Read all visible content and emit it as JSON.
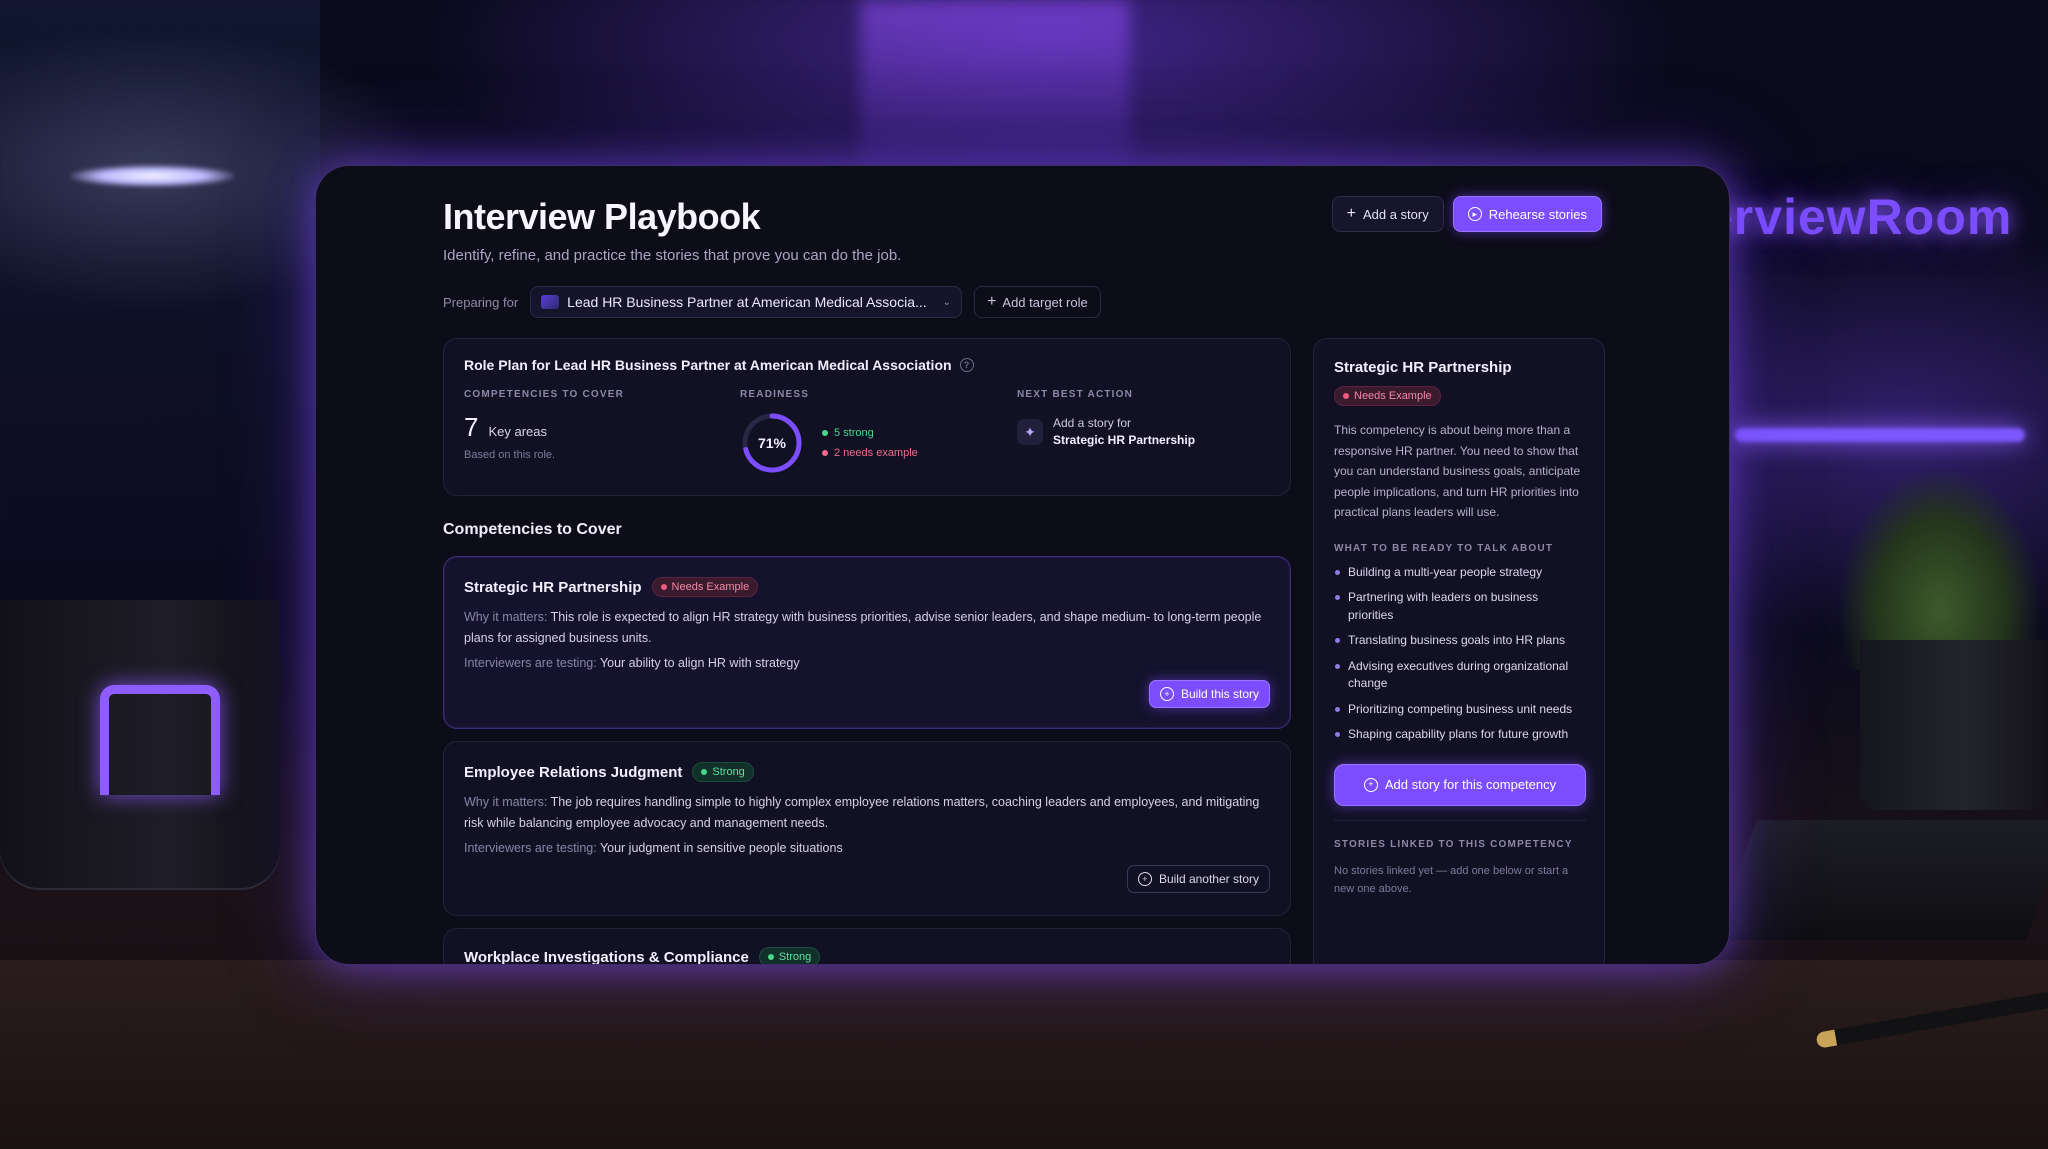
{
  "brand": {
    "neon_text": "erviewRoom"
  },
  "header": {
    "title": "Interview Playbook",
    "subtitle": "Identify, refine, and practice the stories that prove you can do the job.",
    "add_story_label": "Add a story",
    "rehearse_label": "Rehearse stories"
  },
  "prep": {
    "label": "Preparing for",
    "role": "Lead HR Business Partner at American Medical Associa...",
    "add_target_label": "Add target role"
  },
  "plan": {
    "title": "Role Plan for Lead HR Business Partner at American Medical Association",
    "competencies_kicker": "COMPETENCIES TO COVER",
    "competencies_count": "7",
    "competencies_unit": "Key areas",
    "competencies_note": "Based on this role.",
    "readiness_kicker": "READINESS",
    "readiness_percent": "71%",
    "readiness_value": 0.71,
    "strong_label": "5 strong",
    "needs_label": "2 needs example",
    "next_kicker": "NEXT BEST ACTION",
    "next_line1": "Add a story for",
    "next_line2": "Strategic HR Partnership"
  },
  "competencies": {
    "section_title": "Competencies to Cover",
    "items": [
      {
        "name": "Strategic HR Partnership",
        "badge": "Needs Example",
        "why_label": "Why it matters:",
        "why": "This role is expected to align HR strategy with business priorities, advise senior leaders, and shape medium- to long-term people plans for assigned business units.",
        "test_label": "Interviewers are testing:",
        "test": "Your ability to align HR with strategy",
        "button": "Build this story"
      },
      {
        "name": "Employee Relations Judgment",
        "badge": "Strong",
        "why_label": "Why it matters:",
        "why": "The job requires handling simple to highly complex employee relations matters, coaching leaders and employees, and mitigating risk while balancing employee advocacy and management needs.",
        "test_label": "Interviewers are testing:",
        "test": "Your judgment in sensitive people situations",
        "button": "Build another story"
      },
      {
        "name": "Workplace Investigations & Compliance",
        "badge": "Strong"
      }
    ]
  },
  "side": {
    "title": "Strategic HR Partnership",
    "badge": "Needs Example",
    "description": "This competency is about being more than a responsive HR partner. You need to show that you can understand business goals, anticipate people implications, and turn HR priorities into practical plans leaders will use.",
    "talk_kicker": "WHAT TO BE READY TO TALK ABOUT",
    "talk_items": [
      "Building a multi-year people strategy",
      "Partnering with leaders on business priorities",
      "Translating business goals into HR plans",
      "Advising executives during organizational change",
      "Prioritizing competing business unit needs",
      "Shaping capability plans for future growth"
    ],
    "cta": "Add story for this competency",
    "linked_kicker": "STORIES LINKED TO THIS COMPETENCY",
    "linked_note": "No stories linked yet — add one below or start a new one above."
  },
  "colors": {
    "accent": "#7c4dff",
    "strong": "#4ad68b",
    "needs": "#f26a8c",
    "panel_bg": "#0d0c19"
  }
}
